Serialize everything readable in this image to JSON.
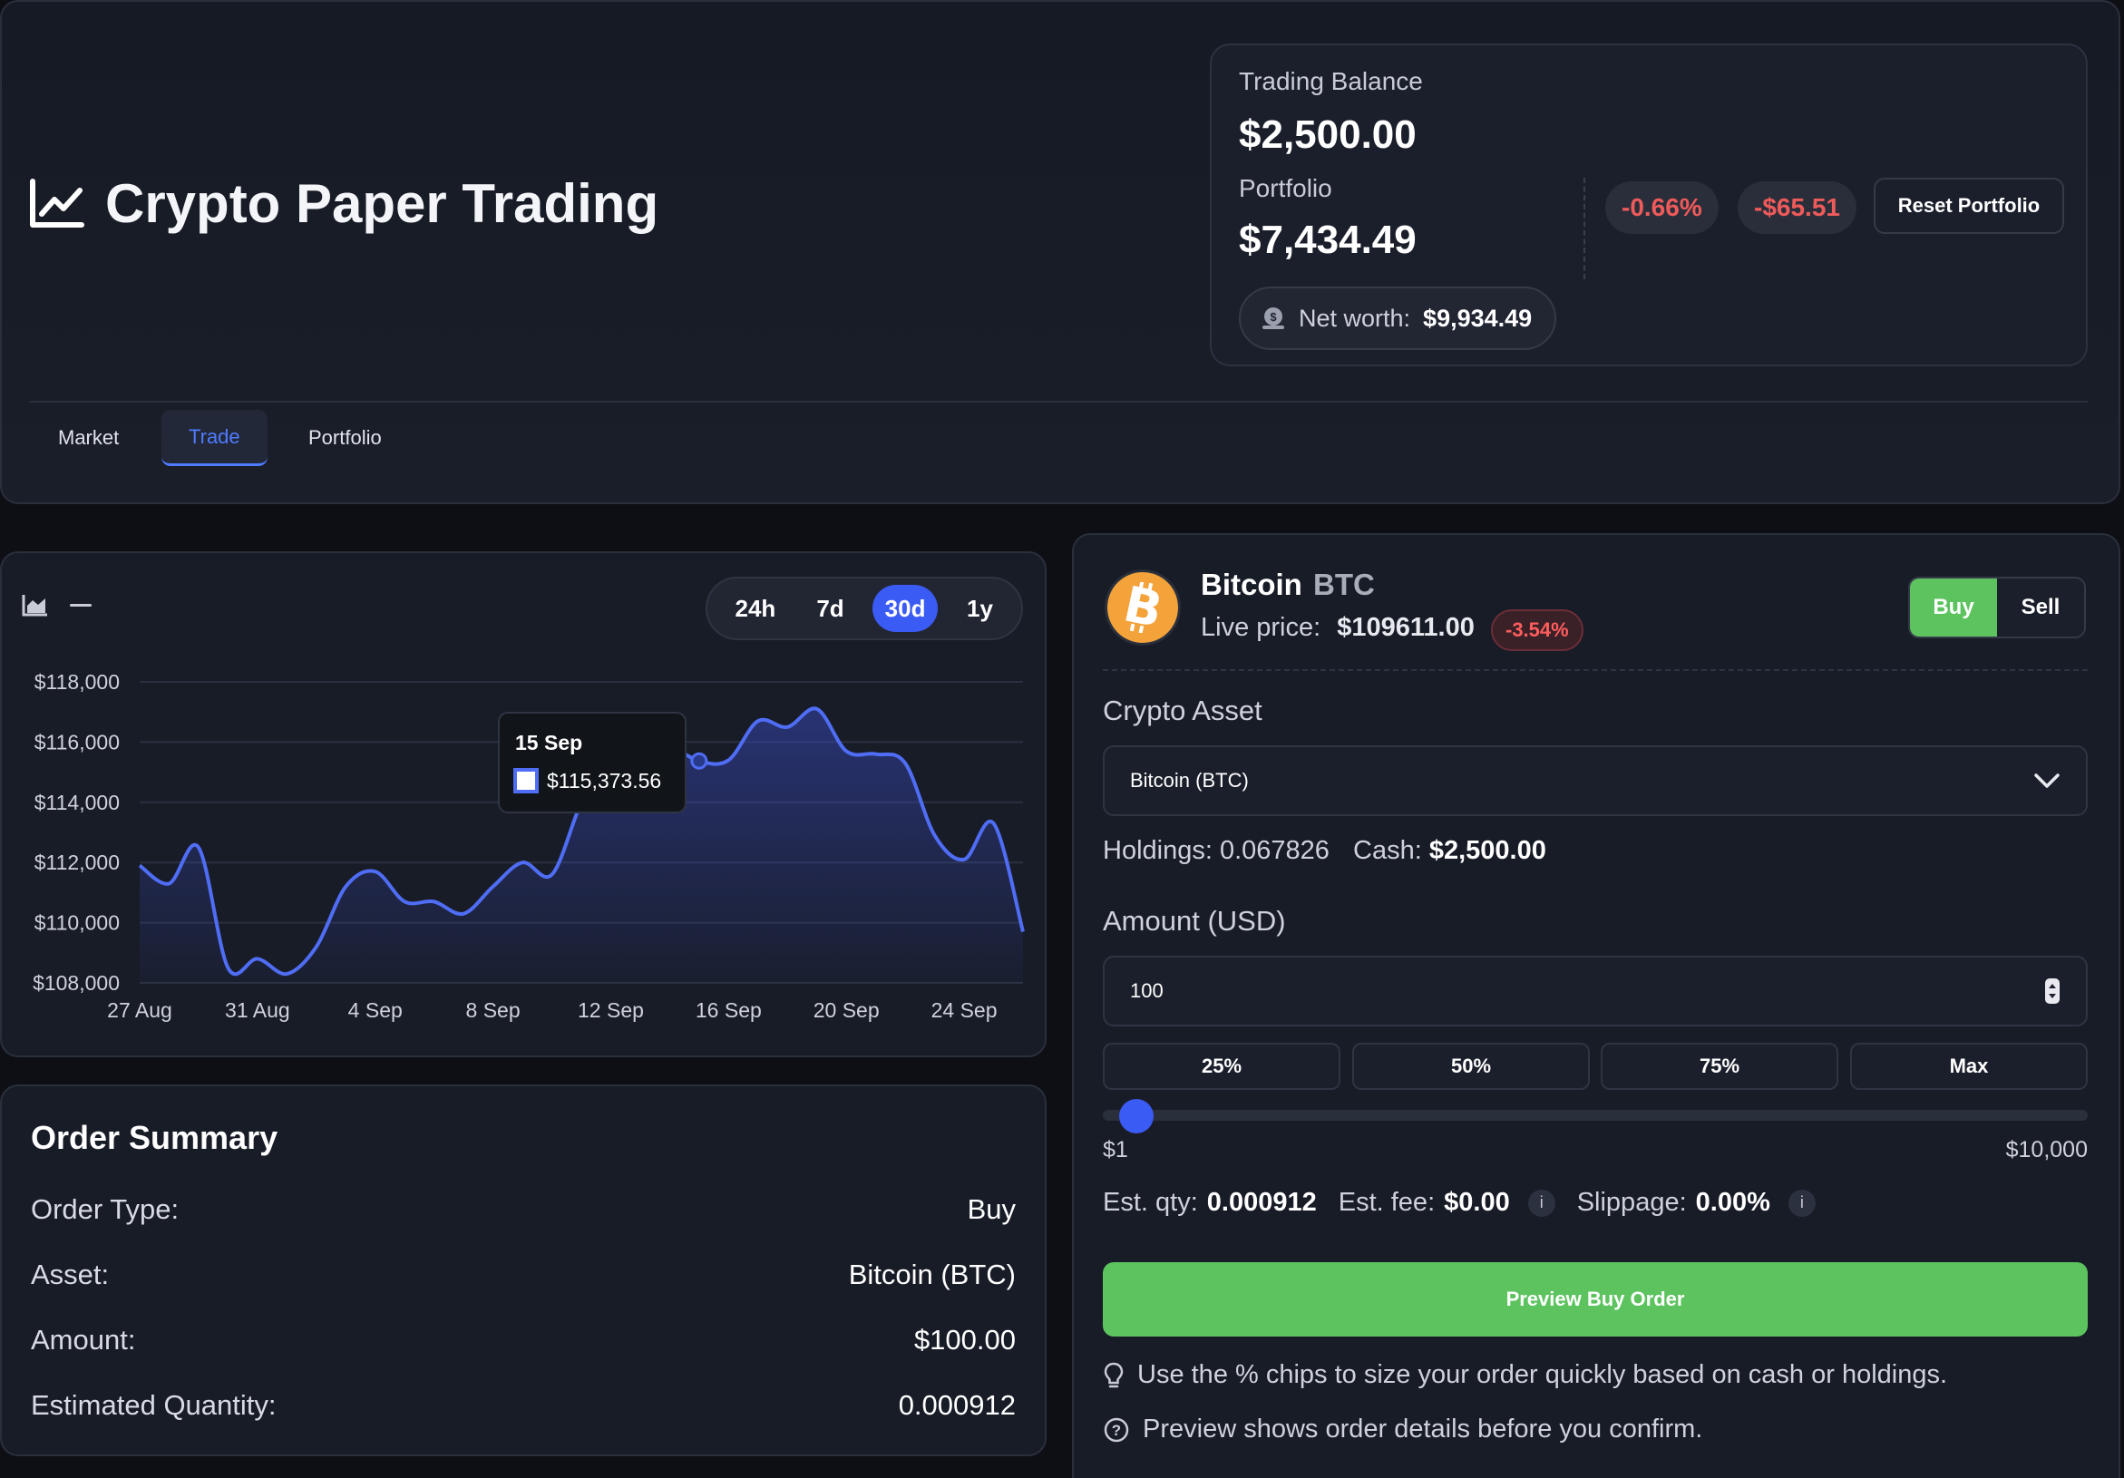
{
  "header": {
    "app_title": "Crypto Paper Trading",
    "trading_balance_label": "Trading Balance",
    "trading_balance_value": "$2,500.00",
    "portfolio_label": "Portfolio",
    "portfolio_value": "$7,434.49",
    "change_pct": "-0.66%",
    "change_usd": "-$65.51",
    "reset_label": "Reset Portfolio",
    "networth_label": "Net worth:",
    "networth_value": "$9,934.49",
    "tabs": [
      {
        "label": "Market",
        "active": false
      },
      {
        "label": "Trade",
        "active": true
      },
      {
        "label": "Portfolio",
        "active": false
      }
    ]
  },
  "chart_panel": {
    "ranges": [
      "24h",
      "7d",
      "30d",
      "1y"
    ],
    "active_range": "30d",
    "tooltip_date": "15 Sep",
    "tooltip_value": "$115,373.56"
  },
  "chart_data": {
    "type": "area",
    "title": "",
    "xlabel": "",
    "ylabel": "",
    "ylim": [
      108000,
      118000
    ],
    "yticks": [
      "$118,000",
      "$116,000",
      "$114,000",
      "$112,000",
      "$110,000",
      "$108,000"
    ],
    "xticks": [
      "27 Aug",
      "31 Aug",
      "4 Sep",
      "8 Sep",
      "12 Sep",
      "16 Sep",
      "20 Sep",
      "24 Sep"
    ],
    "grid": true,
    "accent_color": "#4f6df5",
    "x": [
      "27 Aug",
      "28 Aug",
      "29 Aug",
      "30 Aug",
      "31 Aug",
      "1 Sep",
      "2 Sep",
      "3 Sep",
      "4 Sep",
      "5 Sep",
      "6 Sep",
      "7 Sep",
      "8 Sep",
      "9 Sep",
      "10 Sep",
      "11 Sep",
      "12 Sep",
      "13 Sep",
      "14 Sep",
      "15 Sep",
      "16 Sep",
      "17 Sep",
      "18 Sep",
      "19 Sep",
      "20 Sep",
      "21 Sep",
      "22 Sep",
      "23 Sep",
      "24 Sep",
      "25 Sep",
      "26 Sep"
    ],
    "values": [
      111900,
      111300,
      112500,
      108500,
      108800,
      108300,
      109200,
      111200,
      111700,
      110700,
      110700,
      110300,
      111200,
      112000,
      111600,
      114000,
      115800,
      116200,
      115900,
      115373.56,
      115400,
      116700,
      116500,
      117100,
      115700,
      115600,
      115300,
      112900,
      112100,
      113300,
      109700
    ]
  },
  "order_summary": {
    "title": "Order Summary",
    "rows": [
      {
        "label": "Order Type:",
        "value": "Buy"
      },
      {
        "label": "Asset:",
        "value": "Bitcoin (BTC)"
      },
      {
        "label": "Amount:",
        "value": "$100.00"
      },
      {
        "label": "Estimated Quantity:",
        "value": "0.000912"
      }
    ]
  },
  "trade": {
    "coin_name": "Bitcoin",
    "coin_symbol": "BTC",
    "live_price_label": "Live price:",
    "live_price_value": "$109611.00",
    "live_change": "-3.54%",
    "buy_label": "Buy",
    "sell_label": "Sell",
    "asset_label": "Crypto Asset",
    "asset_selected": "Bitcoin (BTC)",
    "holdings_label": "Holdings:",
    "holdings_value": "0.067826",
    "cash_label": "Cash:",
    "cash_value": "$2,500.00",
    "amount_label": "Amount (USD)",
    "amount_value": "100",
    "chips": [
      "25%",
      "50%",
      "75%",
      "Max"
    ],
    "slider_min": "$1",
    "slider_max": "$10,000",
    "slider_fraction": 0.0099,
    "est_qty_label": "Est. qty:",
    "est_qty_value": "0.000912",
    "est_fee_label": "Est. fee:",
    "est_fee_value": "$0.00",
    "slippage_label": "Slippage:",
    "slippage_value": "0.00%",
    "info_glyph": "i",
    "preview_label": "Preview Buy Order",
    "tip1": "Use the % chips to size your order quickly based on cash or holdings.",
    "tip2": "Preview shows order details before you confirm."
  },
  "colors": {
    "accent_blue": "#3b5bf5",
    "buy_green": "#5cc35f",
    "negative_red": "#ef5a5a",
    "btc_orange": "#f3a33a"
  },
  "icons": {
    "title": "line-chart-icon",
    "networth": "money-bag-icon",
    "chart_area": "area-chart-icon",
    "chart_line": "minus-icon",
    "select": "chevron-down-icon",
    "stepper": "stepper-icon",
    "tip1": "lightbulb-icon",
    "tip2": "question-circle-icon"
  }
}
